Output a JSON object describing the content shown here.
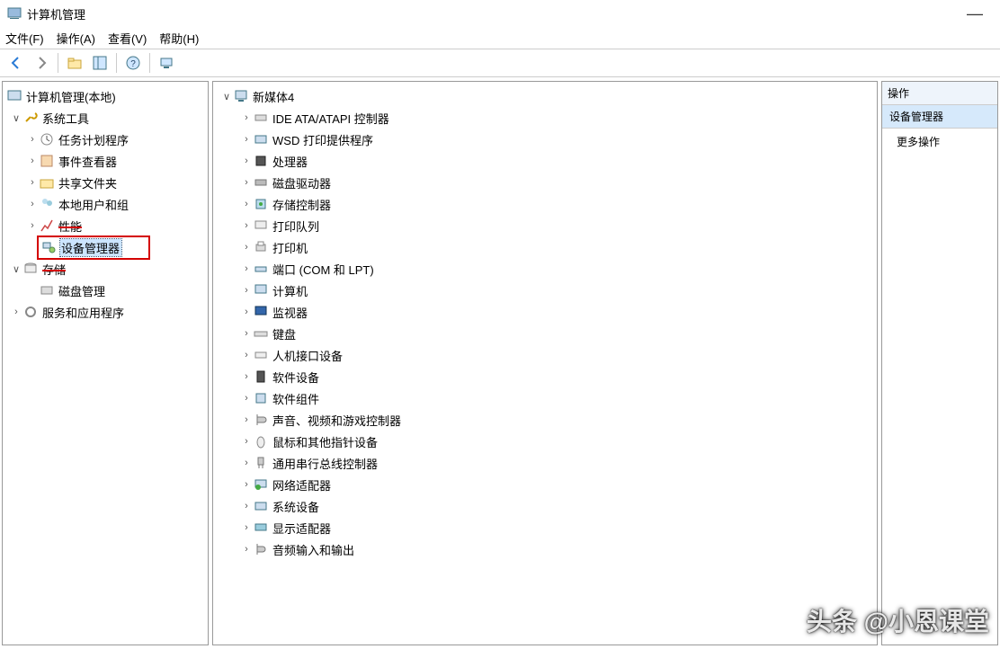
{
  "window": {
    "title": "计算机管理",
    "minimize": "—"
  },
  "menu": {
    "file": "文件(F)",
    "action": "操作(A)",
    "view": "查看(V)",
    "help": "帮助(H)"
  },
  "toolbar": {
    "back": "back-icon",
    "fwd": "fwd-icon",
    "up": "up-icon",
    "show": "show-icon",
    "help": "help-icon",
    "dev": "dev-icon"
  },
  "left_tree": {
    "root": "计算机管理(本地)",
    "n1": "系统工具",
    "n1c0": "任务计划程序",
    "n1c1": "事件查看器",
    "n1c2": "共享文件夹",
    "n1c3": "本地用户和组",
    "n1c4": "性能",
    "n1c5": "设备管理器",
    "n2": "存储",
    "n2c0": "磁盘管理",
    "n3": "服务和应用程序"
  },
  "mid_tree": {
    "root": "新媒体4",
    "c0": "IDE ATA/ATAPI 控制器",
    "c1": "WSD 打印提供程序",
    "c2": "处理器",
    "c3": "磁盘驱动器",
    "c4": "存储控制器",
    "c5": "打印队列",
    "c6": "打印机",
    "c7": "端口 (COM 和 LPT)",
    "c8": "计算机",
    "c9": "监视器",
    "c10": "键盘",
    "c11": "人机接口设备",
    "c12": "软件设备",
    "c13": "软件组件",
    "c14": "声音、视频和游戏控制器",
    "c15": "鼠标和其他指针设备",
    "c16": "通用串行总线控制器",
    "c17": "网络适配器",
    "c18": "系统设备",
    "c19": "显示适配器",
    "c20": "音频输入和输出"
  },
  "actions": {
    "header": "操作",
    "group": "设备管理器",
    "more": "更多操作"
  },
  "watermark": "头条 @小恩课堂"
}
